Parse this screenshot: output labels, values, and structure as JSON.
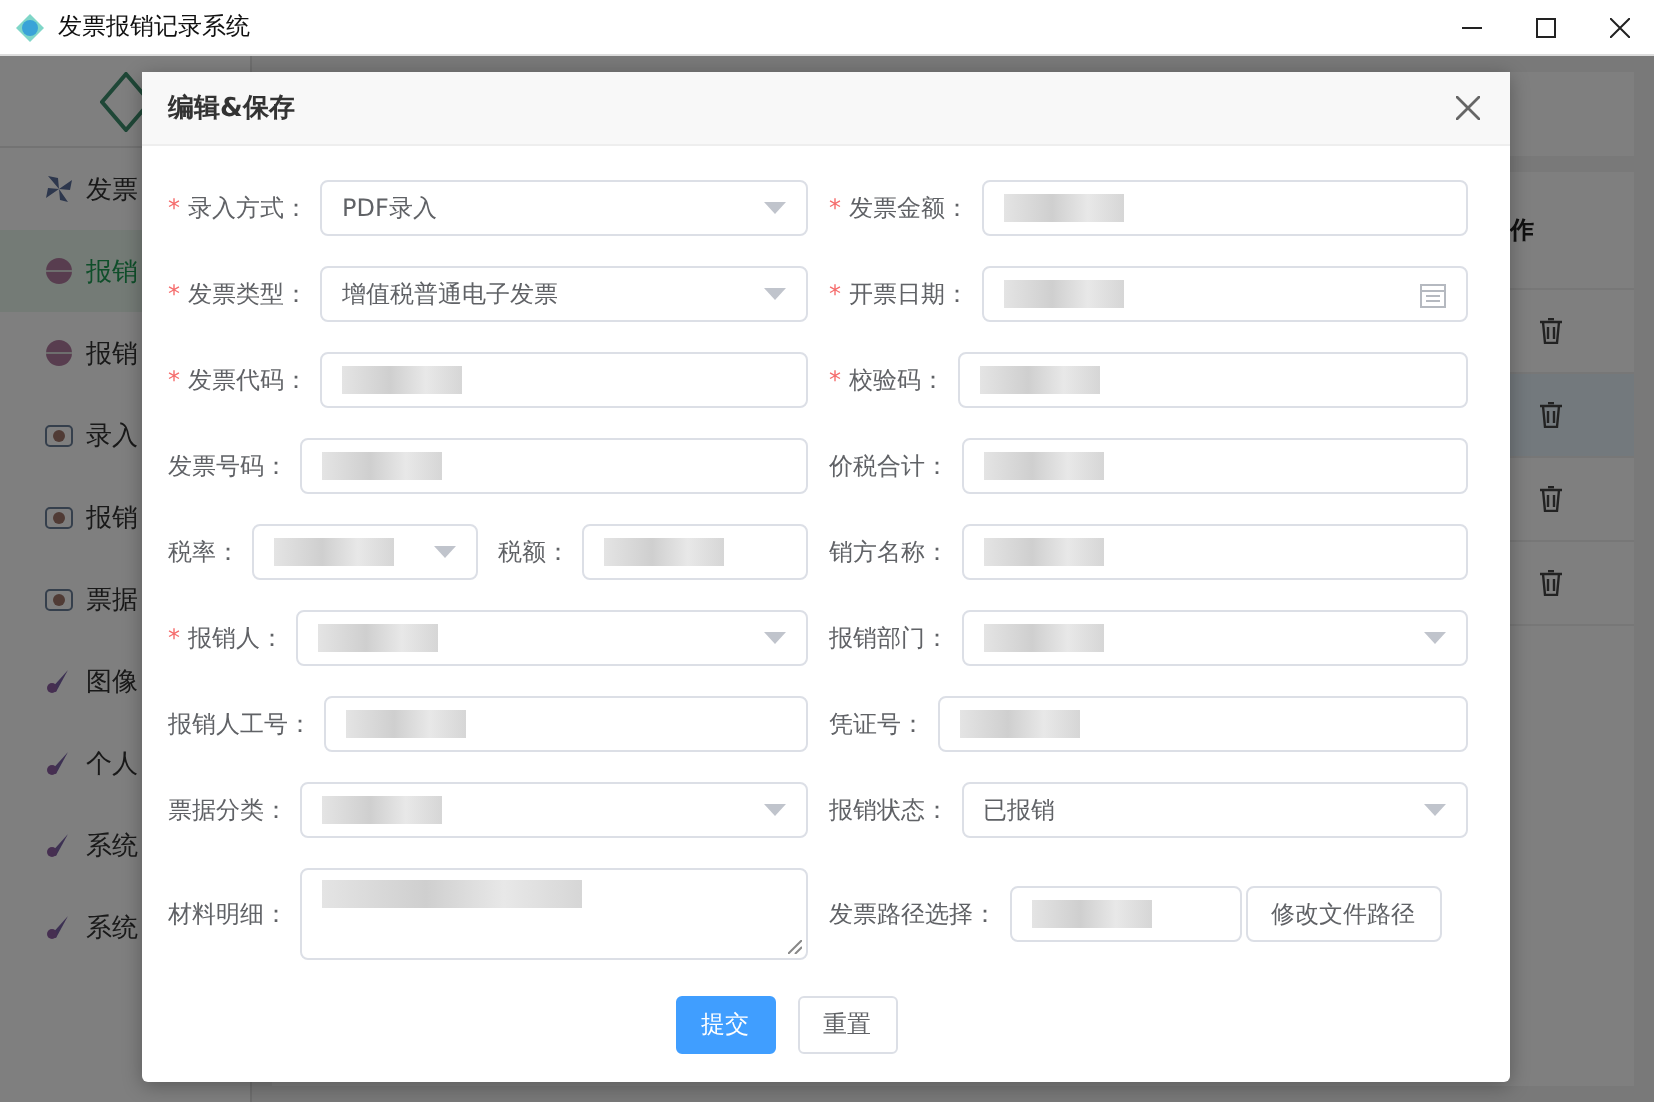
{
  "window": {
    "title": "发票报销记录系统"
  },
  "sidebar": {
    "items": [
      {
        "label": "发票",
        "selected": false
      },
      {
        "label": "报销",
        "selected": true
      },
      {
        "label": "报销",
        "selected": false
      },
      {
        "label": "录入",
        "selected": false
      },
      {
        "label": "报销",
        "selected": false
      },
      {
        "label": "票据",
        "selected": false
      },
      {
        "label": "图像",
        "selected": false
      },
      {
        "label": "个人",
        "selected": false
      },
      {
        "label": "系统",
        "selected": false
      },
      {
        "label": "系统",
        "selected": false
      }
    ]
  },
  "table": {
    "column_header": "作",
    "rows": [
      {
        "selected": false
      },
      {
        "selected": true
      },
      {
        "selected": false
      },
      {
        "selected": false
      }
    ]
  },
  "dialog": {
    "title": "编辑&保存",
    "rows": [
      {
        "left": [
          {
            "mark": "*",
            "label": "录入方式：",
            "kind": "select",
            "value": "PDF录入"
          }
        ],
        "right": [
          {
            "mark": "*",
            "label": "发票金额：",
            "kind": "input",
            "redacted": true
          }
        ]
      },
      {
        "left": [
          {
            "mark": "*",
            "label": "发票类型：",
            "kind": "select",
            "value": "增值税普通电子发票"
          }
        ],
        "right": [
          {
            "mark": "*",
            "label": "开票日期：",
            "kind": "date",
            "redacted": true
          }
        ]
      },
      {
        "left": [
          {
            "mark": "*",
            "label": "发票代码：",
            "kind": "input",
            "redacted": true
          }
        ],
        "right": [
          {
            "mark": "*",
            "label": "校验码：",
            "kind": "input",
            "redacted": true
          }
        ]
      },
      {
        "left": [
          {
            "label": "发票号码：",
            "kind": "input",
            "redacted": true
          }
        ],
        "right": [
          {
            "label": "价税合计：",
            "kind": "input",
            "redacted": true
          }
        ]
      },
      {
        "left": [
          {
            "label": "税率：",
            "kind": "select",
            "redacted": true
          },
          {
            "label": "税额：",
            "kind": "input",
            "redacted": true
          }
        ],
        "right": [
          {
            "label": "销方名称：",
            "kind": "input",
            "redacted": true
          }
        ]
      },
      {
        "left": [
          {
            "mark": "*",
            "label": "报销人：",
            "kind": "select",
            "redacted": true
          }
        ],
        "right": [
          {
            "label": "报销部门：",
            "kind": "select",
            "redacted": true
          }
        ]
      },
      {
        "left": [
          {
            "label": "报销人工号：",
            "kind": "input",
            "redacted": true
          }
        ],
        "right": [
          {
            "label": "凭证号：",
            "kind": "input",
            "redacted": true
          }
        ]
      },
      {
        "left": [
          {
            "label": "票据分类：",
            "kind": "select",
            "redacted": true
          }
        ],
        "right": [
          {
            "label": "报销状态：",
            "kind": "select",
            "value": "已报销"
          }
        ]
      },
      {
        "left": [
          {
            "label": "材料明细：",
            "kind": "textarea",
            "redacted": true
          }
        ],
        "right": [
          {
            "label": "发票路径选择：",
            "kind": "file",
            "redacted": true,
            "button": "修改文件路径"
          }
        ]
      }
    ],
    "buttons": [
      {
        "label": "提交",
        "primary": true
      },
      {
        "label": "重置",
        "primary": false
      }
    ]
  }
}
